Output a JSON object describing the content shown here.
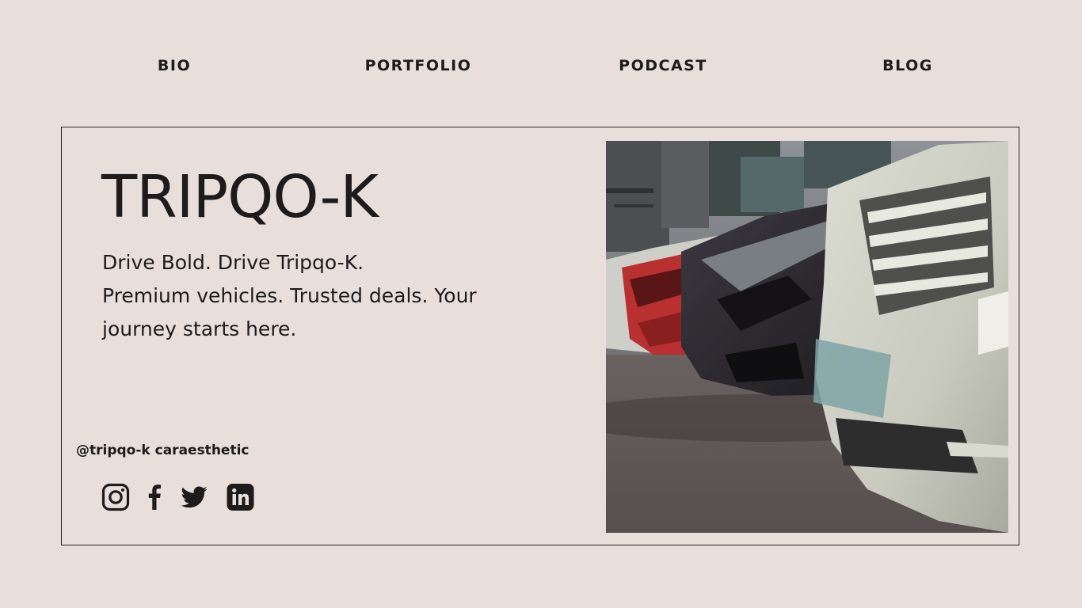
{
  "nav": {
    "items": [
      {
        "label": "BIO"
      },
      {
        "label": "PORTFOLIO"
      },
      {
        "label": "PODCAST"
      },
      {
        "label": "BLOG"
      }
    ]
  },
  "hero": {
    "title": "TRIPQO-K",
    "tagline_line1": "Drive Bold. Drive Tripqo-K.",
    "tagline_line2": "Premium vehicles. Trusted deals. Your journey starts here.",
    "handle": "@tripqo-k caraesthetic",
    "photo_icon": "parked-cars-photo"
  },
  "socials": [
    {
      "icon": "instagram-icon"
    },
    {
      "icon": "facebook-icon"
    },
    {
      "icon": "twitter-icon"
    },
    {
      "icon": "linkedin-icon"
    }
  ],
  "colors": {
    "background": "#e8dfda",
    "text": "#1d1b1b",
    "border": "#2a2626"
  }
}
